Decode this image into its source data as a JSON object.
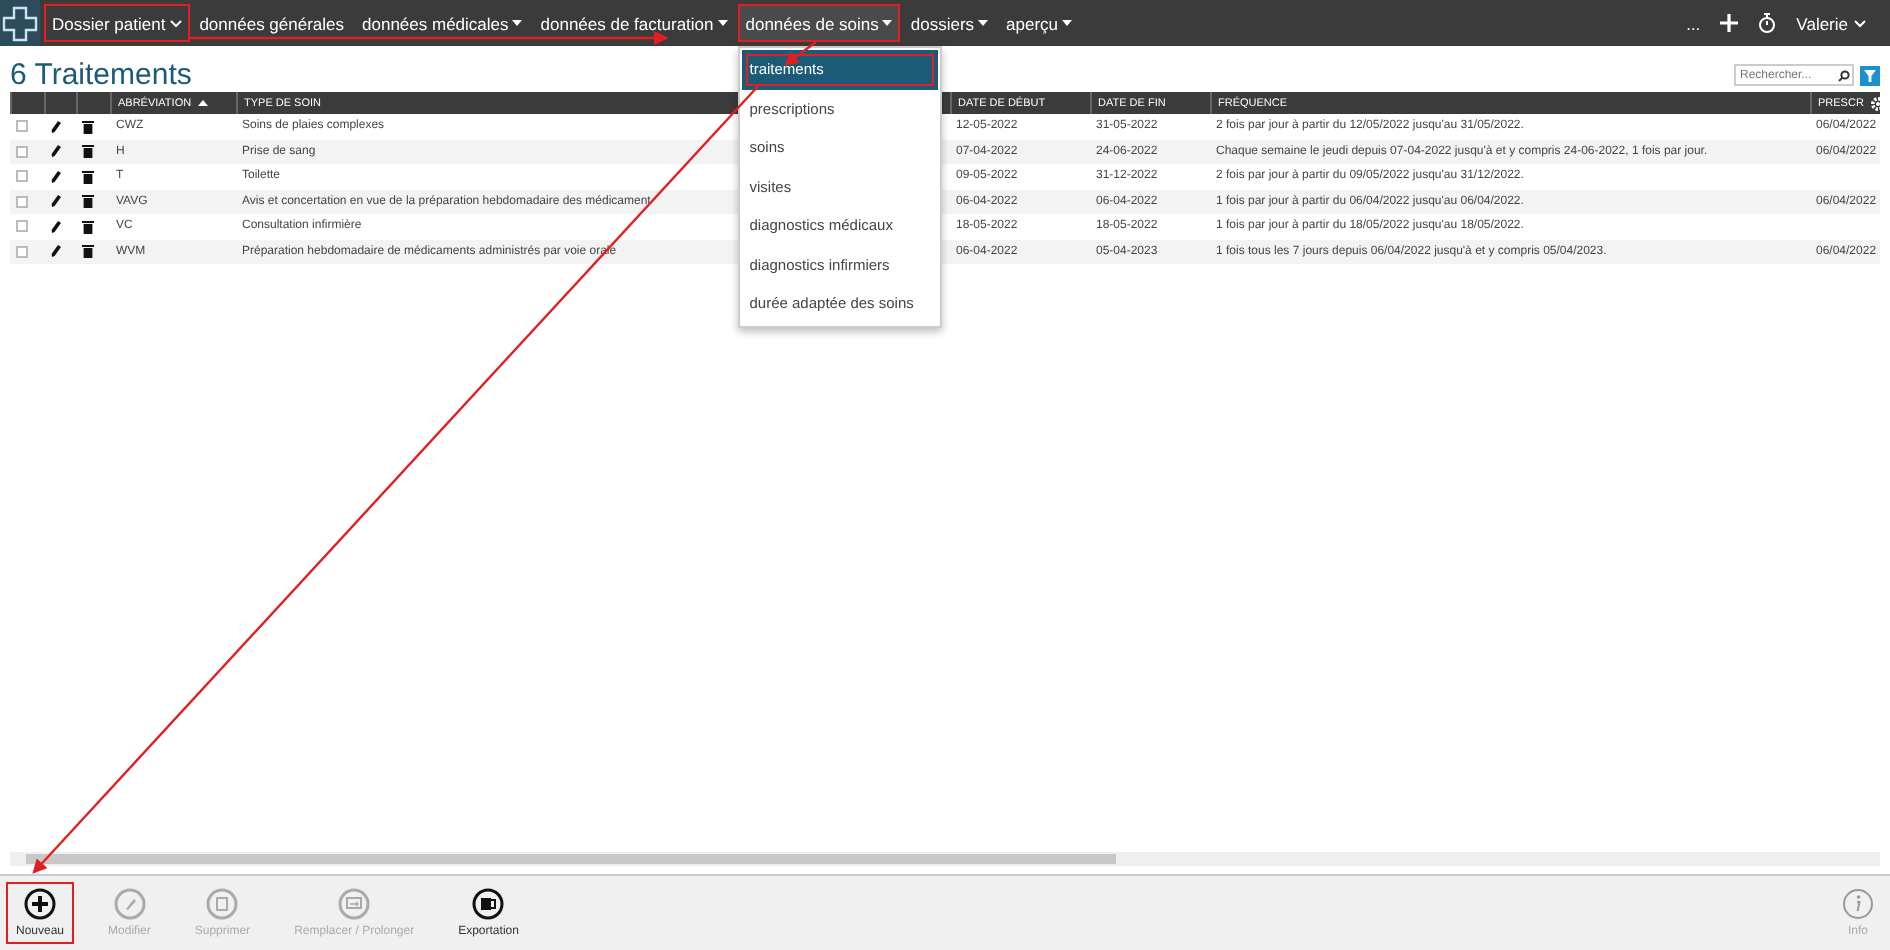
{
  "nav": {
    "items": [
      {
        "label": "Dossier patient",
        "kind": "chevron",
        "highlighted": true,
        "open": false
      },
      {
        "label": "données générales",
        "kind": "plain",
        "highlighted": false,
        "open": false
      },
      {
        "label": "données médicales",
        "kind": "triangle",
        "highlighted": false,
        "open": false
      },
      {
        "label": "données de facturation",
        "kind": "triangle",
        "highlighted": false,
        "open": false
      },
      {
        "label": "données de soins",
        "kind": "triangle",
        "highlighted": true,
        "open": true
      },
      {
        "label": "dossiers",
        "kind": "triangle",
        "highlighted": false,
        "open": false
      },
      {
        "label": "aperçu",
        "kind": "triangle",
        "highlighted": false,
        "open": false
      }
    ],
    "more": "...",
    "user": "Valerie"
  },
  "dropdown": {
    "items": [
      {
        "label": "traitements",
        "selected": true,
        "highlighted": true
      },
      {
        "label": "prescriptions",
        "selected": false,
        "highlighted": false
      },
      {
        "label": "soins",
        "selected": false,
        "highlighted": false
      },
      {
        "label": "visites",
        "selected": false,
        "highlighted": false
      },
      {
        "label": "diagnostics médicaux",
        "selected": false,
        "highlighted": false
      },
      {
        "label": "diagnostics infirmiers",
        "selected": false,
        "highlighted": false
      },
      {
        "label": "durée adaptée des soins",
        "selected": false,
        "highlighted": false
      }
    ]
  },
  "page_title": "6 Traitements",
  "search": {
    "placeholder": "Rechercher..."
  },
  "table": {
    "columns": [
      {
        "label": "ABRÉVIATION",
        "sorted": true
      },
      {
        "label": "TYPE DE SOIN",
        "sorted": false
      },
      {
        "label": "DATE DE DÉBUT",
        "sorted": false
      },
      {
        "label": "DATE DE FIN",
        "sorted": false
      },
      {
        "label": "FRÉQUENCE",
        "sorted": false
      },
      {
        "label": "PRESCR",
        "sorted": false
      }
    ],
    "rows": [
      {
        "checked": false,
        "cells": [
          "CWZ",
          "Soins de plaies complexes",
          "12-05-2022",
          "31-05-2022",
          "2 fois par jour à partir du 12/05/2022 jusqu'au 31/05/2022.",
          "06/04/2022"
        ]
      },
      {
        "checked": false,
        "cells": [
          "H",
          "Prise de sang",
          "07-04-2022",
          "24-06-2022",
          "Chaque semaine le jeudi depuis 07-04-2022 jusqu'à et y compris 24-06-2022, 1 fois par jour.",
          "06/04/2022"
        ]
      },
      {
        "checked": false,
        "cells": [
          "T",
          "Toilette",
          "09-05-2022",
          "31-12-2022",
          "2 fois par jour à partir du 09/05/2022 jusqu'au 31/12/2022.",
          ""
        ]
      },
      {
        "checked": false,
        "cells": [
          "VAVG",
          "Avis et concertation en vue de la préparation hebdomadaire des médicament",
          "06-04-2022",
          "06-04-2022",
          "1 fois par jour à partir du 06/04/2022 jusqu'au 06/04/2022.",
          "06/04/2022"
        ]
      },
      {
        "checked": false,
        "cells": [
          "VC",
          "Consultation infirmière",
          "18-05-2022",
          "18-05-2022",
          "1 fois par jour à partir du 18/05/2022 jusqu'au 18/05/2022.",
          ""
        ]
      },
      {
        "checked": false,
        "cells": [
          "WVM",
          "Préparation hebdomadaire de médicaments administrés par voie orale",
          "06-04-2022",
          "05-04-2023",
          "1 fois tous les 7 jours depuis 06/04/2022 jusqu'à et y compris 05/04/2023.",
          "06/04/2022"
        ]
      }
    ]
  },
  "toolbar": {
    "buttons": [
      {
        "label": "Nouveau",
        "kind": "plus",
        "disabled": false,
        "highlighted": true
      },
      {
        "label": "Modifier",
        "kind": "edit",
        "disabled": true,
        "highlighted": false
      },
      {
        "label": "Supprimer",
        "kind": "delete",
        "disabled": true,
        "highlighted": false
      },
      {
        "label": "Remplacer / Prolonger",
        "kind": "replace",
        "disabled": true,
        "highlighted": false
      },
      {
        "label": "Exportation",
        "kind": "export",
        "disabled": false,
        "highlighted": false
      }
    ],
    "info": "Info"
  }
}
